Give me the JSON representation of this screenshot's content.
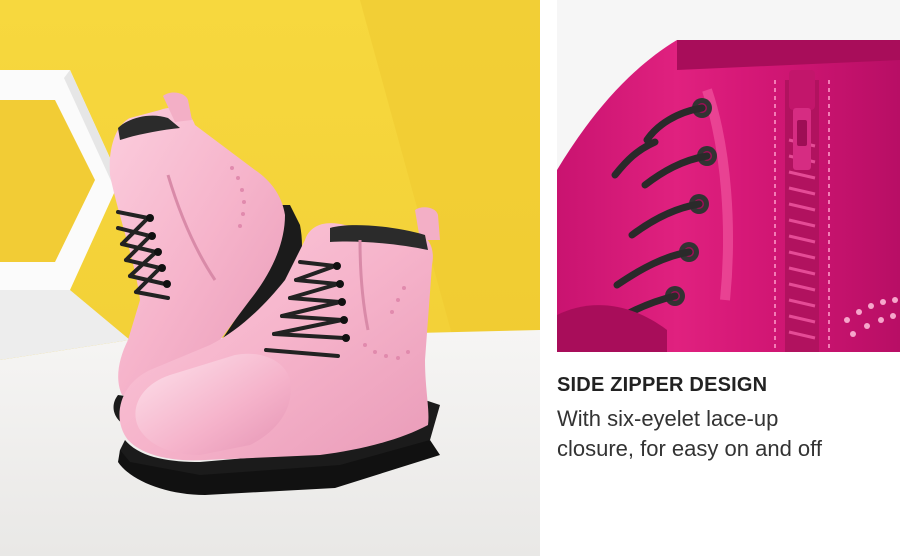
{
  "feature": {
    "title": "SIDE ZIPPER DESIGN",
    "body_line1": "With six-eyelet lace-up",
    "body_line2": "closure, for easy on and off"
  },
  "colors": {
    "backdrop_yellow": "#F5D43C",
    "floor_white": "#F3F2F0",
    "boot_pink": "#F7B8CF",
    "boot_pink_dark": "#E993B4",
    "sole_black": "#1B1B1B",
    "closeup_magenta": "#D91A7A",
    "closeup_magenta_dark": "#9E0E55",
    "closeup_bg": "#F6F6F6",
    "lace_black": "#2a2a2a"
  },
  "images": {
    "left_photo": "pink-patent-boots-photo",
    "right_photo": "magenta-boot-zipper-closeup"
  }
}
